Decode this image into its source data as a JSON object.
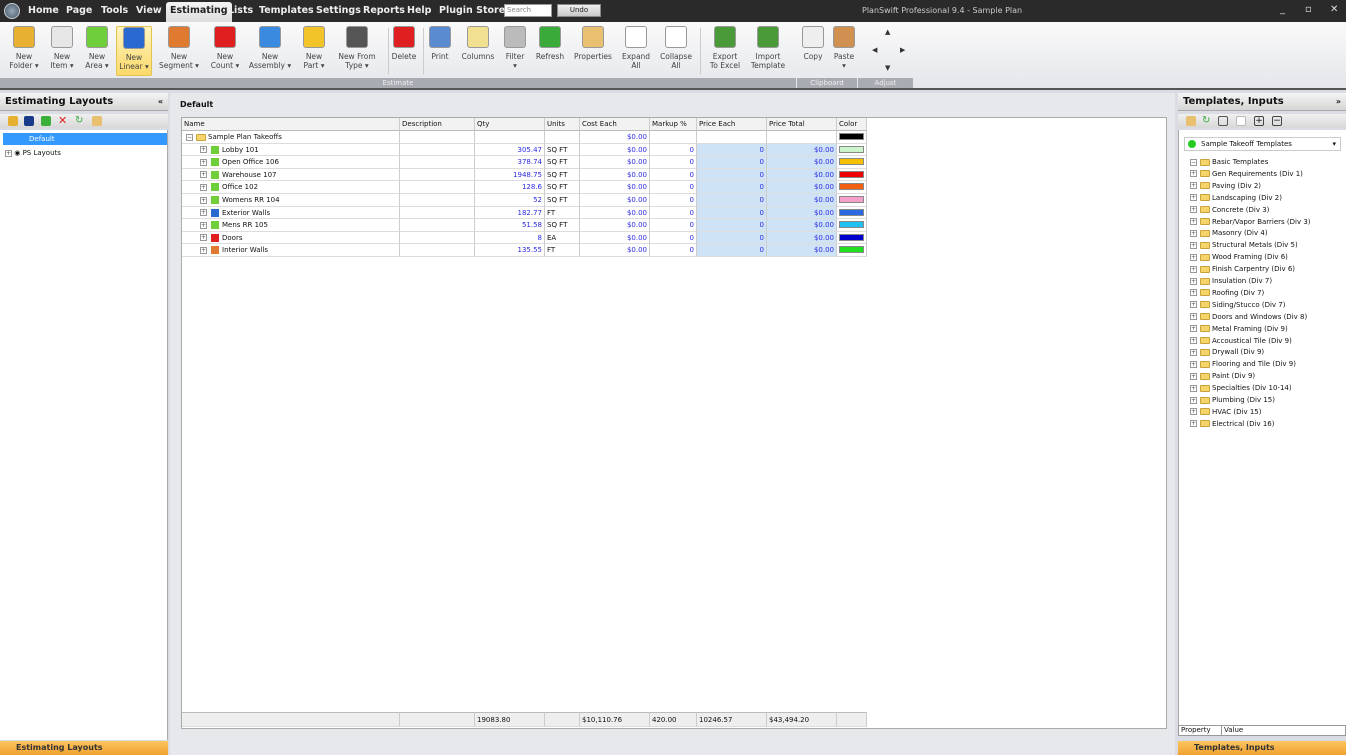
{
  "app": {
    "title": "PlanSwift Professional 9.4 - Sample Plan",
    "search_placeholder": "Search",
    "undo": "Undo",
    "win": [
      "_",
      "▫",
      "✕"
    ]
  },
  "menu": [
    "Home",
    "Page",
    "Tools",
    "View",
    "Estimating",
    "Lists",
    "Templates",
    "Settings",
    "Reports",
    "Help",
    "Plugin Store"
  ],
  "ribbon": {
    "buttons": [
      {
        "l1": "New",
        "l2": "Folder ▾",
        "color": "#e8b030"
      },
      {
        "l1": "New",
        "l2": "Item ▾",
        "color": "#e6e6e6"
      },
      {
        "l1": "New",
        "l2": "Area ▾",
        "color": "#6fcf3a"
      },
      {
        "l1": "New",
        "l2": "Linear ▾",
        "color": "#2a6ad0"
      },
      {
        "l1": "New",
        "l2": "Segment ▾",
        "color": "#e07a30"
      },
      {
        "l1": "New",
        "l2": "Count ▾",
        "color": "#e02020"
      },
      {
        "l1": "New",
        "l2": "Assembly ▾",
        "color": "#3a8ae0"
      },
      {
        "l1": "New",
        "l2": "Part ▾",
        "color": "#f3c42a"
      },
      {
        "l1": "New From",
        "l2": "Type ▾",
        "color": "#555"
      },
      {
        "l1": "Delete",
        "l2": "",
        "color": "#e02020"
      },
      {
        "l1": "Print",
        "l2": "",
        "color": "#5a8ad0"
      },
      {
        "l1": "Columns",
        "l2": "",
        "color": "#f0e090"
      },
      {
        "l1": "Filter",
        "l2": "▾",
        "color": "#bbb"
      },
      {
        "l1": "Refresh",
        "l2": "",
        "color": "#3aaa3a"
      },
      {
        "l1": "Properties",
        "l2": "",
        "color": "#e8c070"
      },
      {
        "l1": "Expand",
        "l2": "All",
        "color": "#fff"
      },
      {
        "l1": "Collapse",
        "l2": "All",
        "color": "#fff"
      },
      {
        "l1": "Export",
        "l2": "To Excel",
        "color": "#4a9a3a"
      },
      {
        "l1": "Import",
        "l2": "Template",
        "color": "#4a9a3a"
      },
      {
        "l1": "Copy",
        "l2": "",
        "color": "#eee"
      },
      {
        "l1": "Paste",
        "l2": "▾",
        "color": "#d09050"
      }
    ],
    "groups": [
      "Estimate",
      "Clipboard",
      "Adjust"
    ]
  },
  "left": {
    "title": "Estimating Layouts",
    "items": [
      "Default",
      "PS Layouts"
    ],
    "footer": "Estimating Layouts"
  },
  "main": {
    "title": "Default",
    "columns": [
      "Name",
      "Description",
      "Qty",
      "Units",
      "Cost Each",
      "Markup %",
      "Price Each",
      "Price Total",
      "Color"
    ],
    "root": {
      "name": "Sample Plan Takeoffs",
      "cost": "$0.00",
      "color": "#000000"
    },
    "rows": [
      {
        "name": "Lobby 101",
        "type": "area",
        "qty": "305.47",
        "units": "SQ FT",
        "cost": "$0.00",
        "markup": "0",
        "price": "0",
        "total": "$0.00",
        "color": "#ccf5cc"
      },
      {
        "name": "Open Office 106",
        "type": "area",
        "qty": "378.74",
        "units": "SQ FT",
        "cost": "$0.00",
        "markup": "0",
        "price": "0",
        "total": "$0.00",
        "color": "#f5c000"
      },
      {
        "name": "Warehouse 107",
        "type": "area",
        "qty": "1948.75",
        "units": "SQ FT",
        "cost": "$0.00",
        "markup": "0",
        "price": "0",
        "total": "$0.00",
        "color": "#ee0000"
      },
      {
        "name": "Office 102",
        "type": "area",
        "qty": "128.6",
        "units": "SQ FT",
        "cost": "$0.00",
        "markup": "0",
        "price": "0",
        "total": "$0.00",
        "color": "#f06010"
      },
      {
        "name": "Womens RR 104",
        "type": "area",
        "qty": "52",
        "units": "SQ FT",
        "cost": "$0.00",
        "markup": "0",
        "price": "0",
        "total": "$0.00",
        "color": "#f5a0c8"
      },
      {
        "name": "Exterior Walls",
        "type": "linear",
        "qty": "182.77",
        "units": "FT",
        "cost": "$0.00",
        "markup": "0",
        "price": "0",
        "total": "$0.00",
        "color": "#2a6ae0"
      },
      {
        "name": "Mens RR 105",
        "type": "area",
        "qty": "51.58",
        "units": "SQ FT",
        "cost": "$0.00",
        "markup": "0",
        "price": "0",
        "total": "$0.00",
        "color": "#20c0f0"
      },
      {
        "name": "Doors",
        "type": "count",
        "qty": "8",
        "units": "EA",
        "cost": "$0.00",
        "markup": "0",
        "price": "0",
        "total": "$0.00",
        "color": "#0000cc"
      },
      {
        "name": "Interior Walls",
        "type": "segment",
        "qty": "135.55",
        "units": "FT",
        "cost": "$0.00",
        "markup": "0",
        "price": "0",
        "total": "$0.00",
        "color": "#20e020"
      }
    ],
    "totals": {
      "qty": "19083.80",
      "cost": "$10,110.76",
      "markup": "420.00",
      "price": "10246.57",
      "total": "$43,494.20"
    }
  },
  "right": {
    "title": "Templates, Inputs",
    "dropdown": "Sample Takeoff Templates",
    "items": [
      "Basic Templates",
      "Gen Requirements (Div 1)",
      "Paving (Div 2)",
      "Landscaping (Div 2)",
      "Concrete (Div 3)",
      "Rebar/Vapor Barriers (Div 3)",
      "Masonry (Div 4)",
      "Structural Metals (Div 5)",
      "Wood Framing (Div 6)",
      "Finish Carpentry (Div 6)",
      "Insulation (Div 7)",
      "Roofing (Div 7)",
      "Siding/Stucco (Div 7)",
      "Doors and Windows (Div 8)",
      "Metal Framing (Div 9)",
      "Accoustical Tile (Div 9)",
      "Drywall (Div 9)",
      "Flooring and Tile (Div 9)",
      "Paint (Div 9)",
      "Specialties (Div 10-14)",
      "Plumbing (Div 15)",
      "HVAC (Div 15)",
      "Electrical (Div 16)"
    ],
    "prop_cols": [
      "Property",
      "Value"
    ],
    "footer": "Templates, Inputs"
  }
}
